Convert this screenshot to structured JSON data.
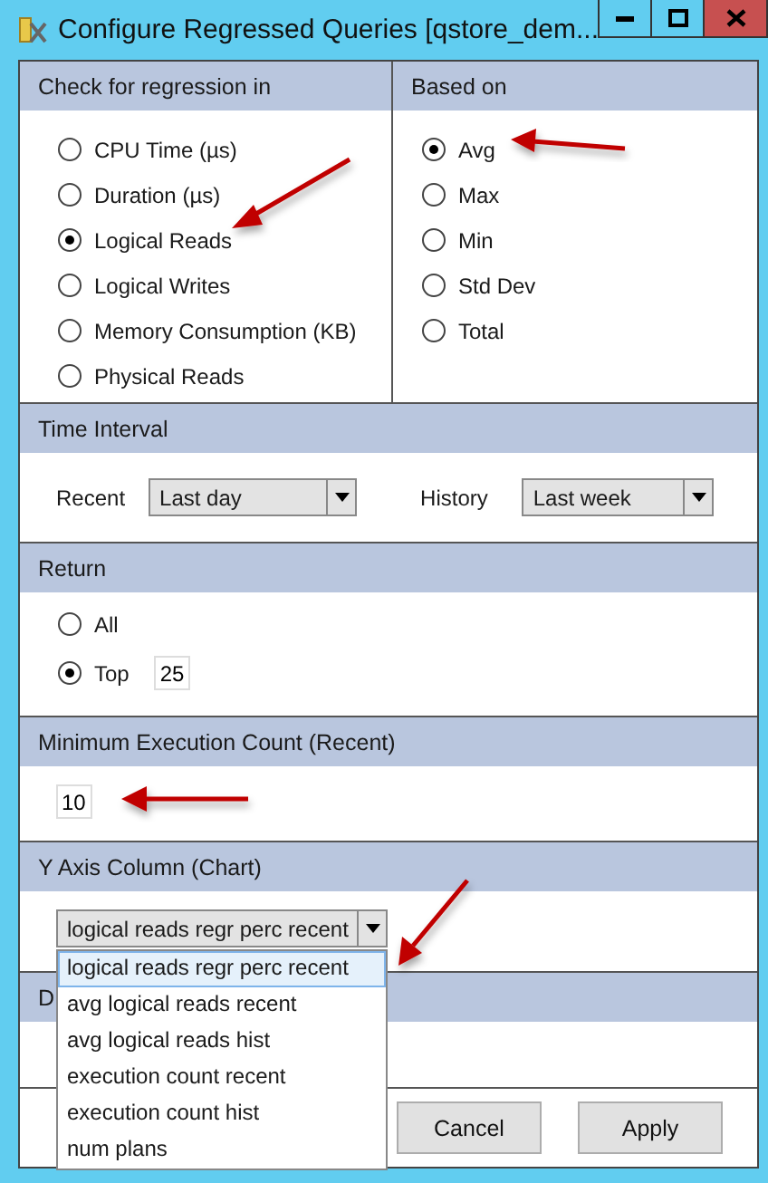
{
  "window": {
    "title": "Configure Regressed Queries [qstore_dem..."
  },
  "regression_metric": {
    "header": "Check for regression in",
    "options": [
      {
        "label": "CPU Time (µs)",
        "selected": false
      },
      {
        "label": "Duration (µs)",
        "selected": false
      },
      {
        "label": "Logical Reads",
        "selected": true
      },
      {
        "label": "Logical Writes",
        "selected": false
      },
      {
        "label": "Memory Consumption (KB)",
        "selected": false
      },
      {
        "label": "Physical Reads",
        "selected": false
      }
    ]
  },
  "based_on": {
    "header": "Based on",
    "options": [
      {
        "label": "Avg",
        "selected": true
      },
      {
        "label": "Max",
        "selected": false
      },
      {
        "label": "Min",
        "selected": false
      },
      {
        "label": "Std Dev",
        "selected": false
      },
      {
        "label": "Total",
        "selected": false
      }
    ]
  },
  "time_interval": {
    "header": "Time Interval",
    "recent": {
      "label": "Recent",
      "value": "Last day"
    },
    "history": {
      "label": "History",
      "value": "Last week"
    }
  },
  "return": {
    "header": "Return",
    "options": [
      {
        "label": "All",
        "selected": false
      },
      {
        "label": "Top",
        "selected": true,
        "value": "25"
      }
    ]
  },
  "minimum_execution_count": {
    "header": "Minimum Execution Count (Recent)",
    "value": "10"
  },
  "y_axis_column": {
    "header": "Y Axis Column (Chart)",
    "value": "logical reads regr perc recent",
    "expanded": true,
    "options": [
      {
        "label": "logical reads regr perc recent",
        "selected": true
      },
      {
        "label": "avg logical reads recent",
        "selected": false
      },
      {
        "label": "avg logical reads hist",
        "selected": false
      },
      {
        "label": "execution count recent",
        "selected": false
      },
      {
        "label": "execution count hist",
        "selected": false
      },
      {
        "label": "num plans",
        "selected": false
      }
    ]
  },
  "section_6": {
    "header": "D"
  },
  "buttons": [
    "Cancel",
    "Apply"
  ]
}
